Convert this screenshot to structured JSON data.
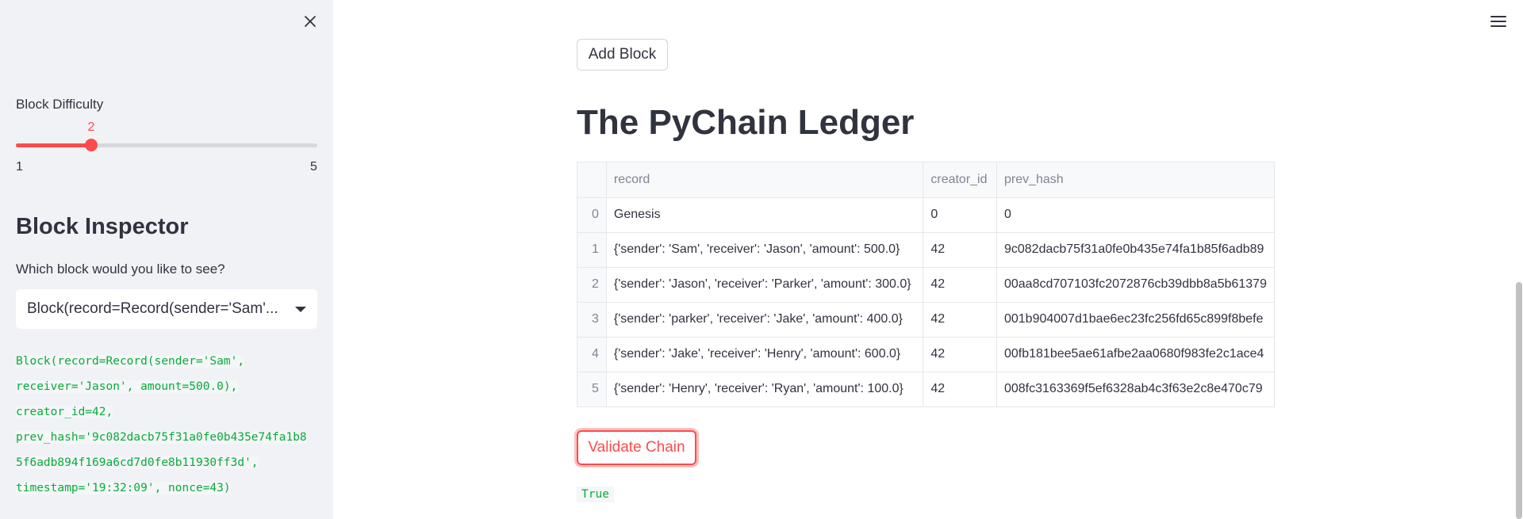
{
  "sidebar": {
    "slider": {
      "label": "Block Difficulty",
      "value": 2,
      "value_text": "2",
      "min": 1,
      "max": 5,
      "min_text": "1",
      "max_text": "5"
    },
    "inspector_title": "Block Inspector",
    "select_label": "Which block would you like to see?",
    "select_value": "Block(record=Record(sender='Sam'...",
    "code_lines": [
      "Block(record=Record(sender='Sam',",
      "receiver='Jason', amount=500.0),",
      "creator_id=42,",
      "prev_hash='9c082dacb75f31a0fe0b435e74fa1b8",
      "5f6adb894f169a6cd7d0fe8b11930ff3d',",
      "timestamp='19:32:09', nonce=43)"
    ]
  },
  "main": {
    "add_block_label": "Add Block",
    "ledger_title": "The PyChain Ledger",
    "table": {
      "columns": [
        "",
        "record",
        "creator_id",
        "prev_hash"
      ],
      "rows": [
        [
          "0",
          "Genesis",
          "0",
          "0"
        ],
        [
          "1",
          "{'sender': 'Sam', 'receiver': 'Jason', 'amount': 500.0}",
          "42",
          "9c082dacb75f31a0fe0b435e74fa1b85f6adb89"
        ],
        [
          "2",
          "{'sender': 'Jason', 'receiver': 'Parker', 'amount': 300.0}",
          "42",
          "00aa8cd707103fc2072876cb39dbb8a5b61379"
        ],
        [
          "3",
          "{'sender': 'parker', 'receiver': 'Jake', 'amount': 400.0}",
          "42",
          "001b904007d1bae6ec23fc256fd65c899f8befe"
        ],
        [
          "4",
          "{'sender': 'Jake', 'receiver': 'Henry', 'amount': 600.0}",
          "42",
          "00fb181bee5ae61afbe2aa0680f983fe2c1ace4"
        ],
        [
          "5",
          "{'sender': 'Henry', 'receiver': 'Ryan', 'amount': 100.0}",
          "42",
          "008fc3163369f5ef6328ab4c3f63e2c8e470c79"
        ]
      ]
    },
    "validate_label": "Validate Chain",
    "result": "True"
  },
  "colors": {
    "accent": "#FF4B4B",
    "code_green": "#09AB3B",
    "sidebar_bg": "#F0F2F6",
    "text": "#31333F"
  },
  "icons": {
    "close": "close-icon",
    "menu": "hamburger-menu-icon",
    "caret": "chevron-down-icon"
  }
}
